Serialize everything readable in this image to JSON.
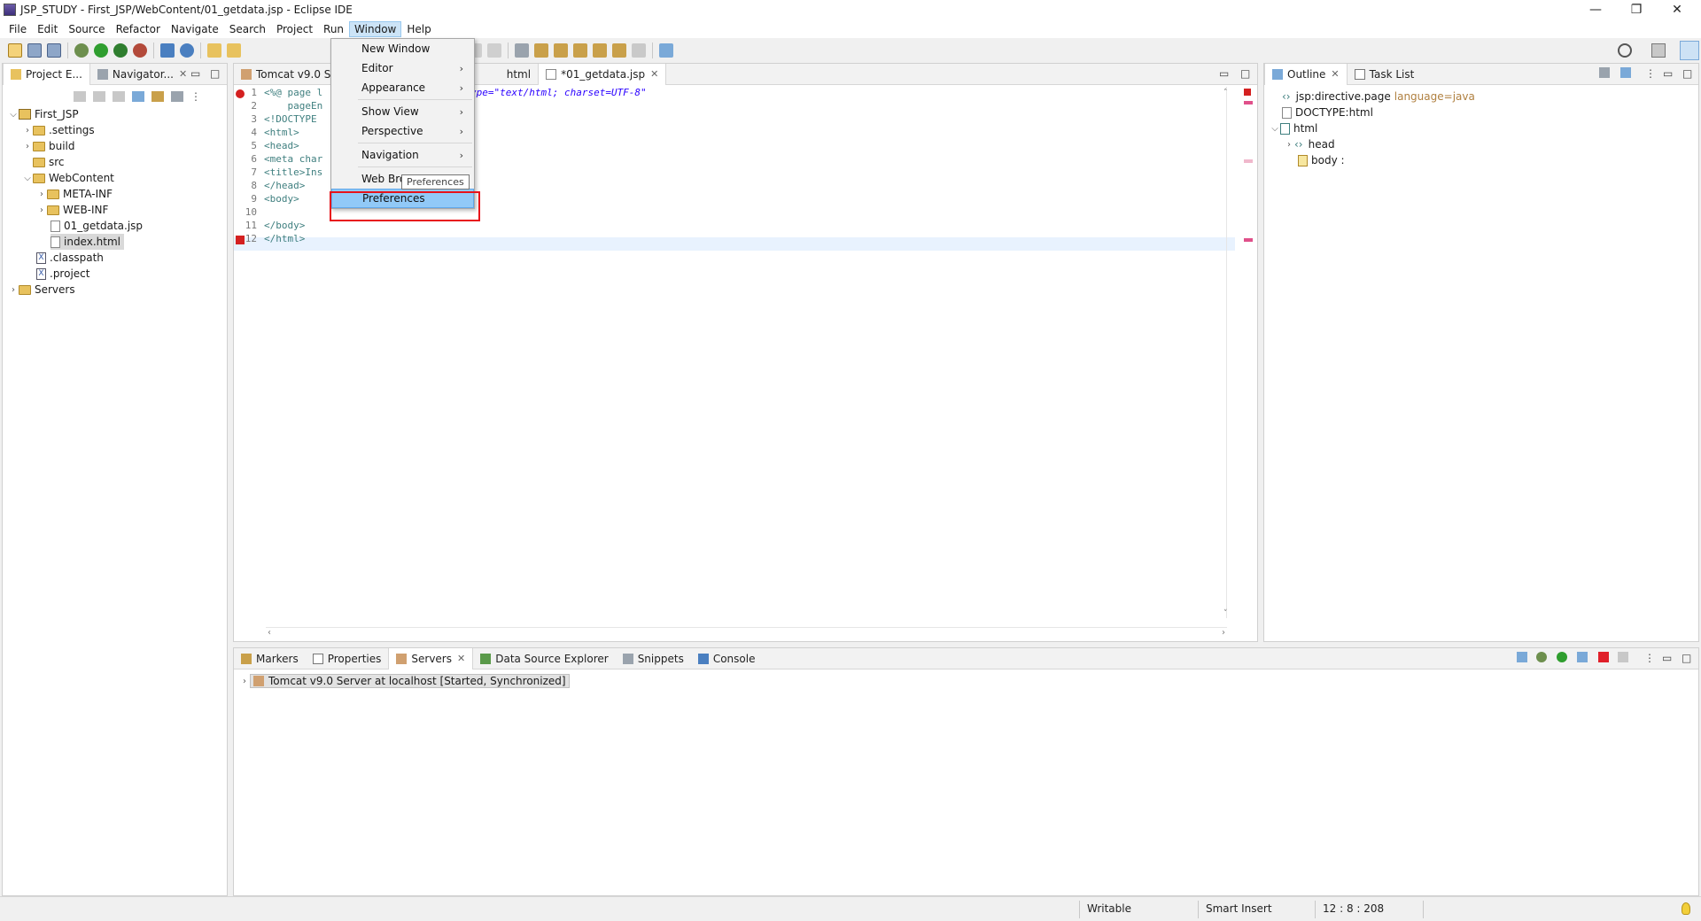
{
  "window": {
    "title": "JSP_STUDY - First_JSP/WebContent/01_getdata.jsp - Eclipse IDE",
    "minimize": "—",
    "restore": "❐",
    "close": "✕"
  },
  "menubar": [
    "File",
    "Edit",
    "Source",
    "Refactor",
    "Navigate",
    "Search",
    "Project",
    "Run",
    "Window",
    "Help"
  ],
  "left_panel": {
    "tabs": [
      "Project E...",
      "Navigator..."
    ],
    "tree": [
      {
        "label": "First_JSP",
        "kind": "project",
        "expanded": true
      },
      {
        "label": ".settings",
        "kind": "folder"
      },
      {
        "label": "build",
        "kind": "folder"
      },
      {
        "label": "src",
        "kind": "folder"
      },
      {
        "label": "WebContent",
        "kind": "folder",
        "expanded": true
      },
      {
        "label": "META-INF",
        "kind": "folder"
      },
      {
        "label": "WEB-INF",
        "kind": "folder"
      },
      {
        "label": "01_getdata.jsp",
        "kind": "file"
      },
      {
        "label": "index.html",
        "kind": "file",
        "selected": true
      },
      {
        "label": ".classpath",
        "kind": "xfile"
      },
      {
        "label": ".project",
        "kind": "xfile"
      },
      {
        "label": "Servers",
        "kind": "folder"
      }
    ]
  },
  "editor": {
    "tabs": [
      "Tomcat v9.0 Ser",
      "html",
      "*01_getdata.jsp"
    ],
    "lines": [
      {
        "n": "1",
        "pre": "<%@ page l",
        "post": "ype=\"text/html; charset=UTF-8\""
      },
      {
        "n": "2",
        "pre": "    pageEn",
        "post": ""
      },
      {
        "n": "3",
        "pre": "<!DOCTYPE ",
        "post": ""
      },
      {
        "n": "4",
        "pre": "<html>",
        "post": ""
      },
      {
        "n": "5",
        "pre": "<head>",
        "post": ""
      },
      {
        "n": "6",
        "pre": "<meta char",
        "post": ""
      },
      {
        "n": "7",
        "pre": "<title>Ins",
        "post": ""
      },
      {
        "n": "8",
        "pre": "</head>",
        "post": ""
      },
      {
        "n": "9",
        "pre": "<body>",
        "post": ""
      },
      {
        "n": "10",
        "pre": "",
        "post": ""
      },
      {
        "n": "11",
        "pre": "</body>",
        "post": ""
      },
      {
        "n": "12",
        "pre": "</html>",
        "post": ""
      }
    ]
  },
  "window_menu": {
    "items": [
      "New Window",
      "Editor",
      "Appearance",
      "Show View",
      "Perspective",
      "Navigation",
      "Web Bro",
      "Preferences"
    ],
    "tooltip": "Preferences"
  },
  "outline": {
    "tabs": [
      "Outline",
      "Task List"
    ],
    "items": [
      {
        "label": "jsp:directive.page",
        "extra": "language=java"
      },
      {
        "label": "DOCTYPE:html",
        "extra": ""
      },
      {
        "label": "html",
        "extra": ""
      },
      {
        "label": "head",
        "extra": ""
      },
      {
        "label": "body :",
        "extra": ""
      }
    ]
  },
  "bottom_panel": {
    "tabs": [
      "Markers",
      "Properties",
      "Servers",
      "Data Source Explorer",
      "Snippets",
      "Console"
    ],
    "server_row": "Tomcat v9.0 Server at localhost  [Started, Synchronized]"
  },
  "status": {
    "writable": "Writable",
    "insert_mode": "Smart Insert",
    "position": "12 : 8 : 208"
  }
}
